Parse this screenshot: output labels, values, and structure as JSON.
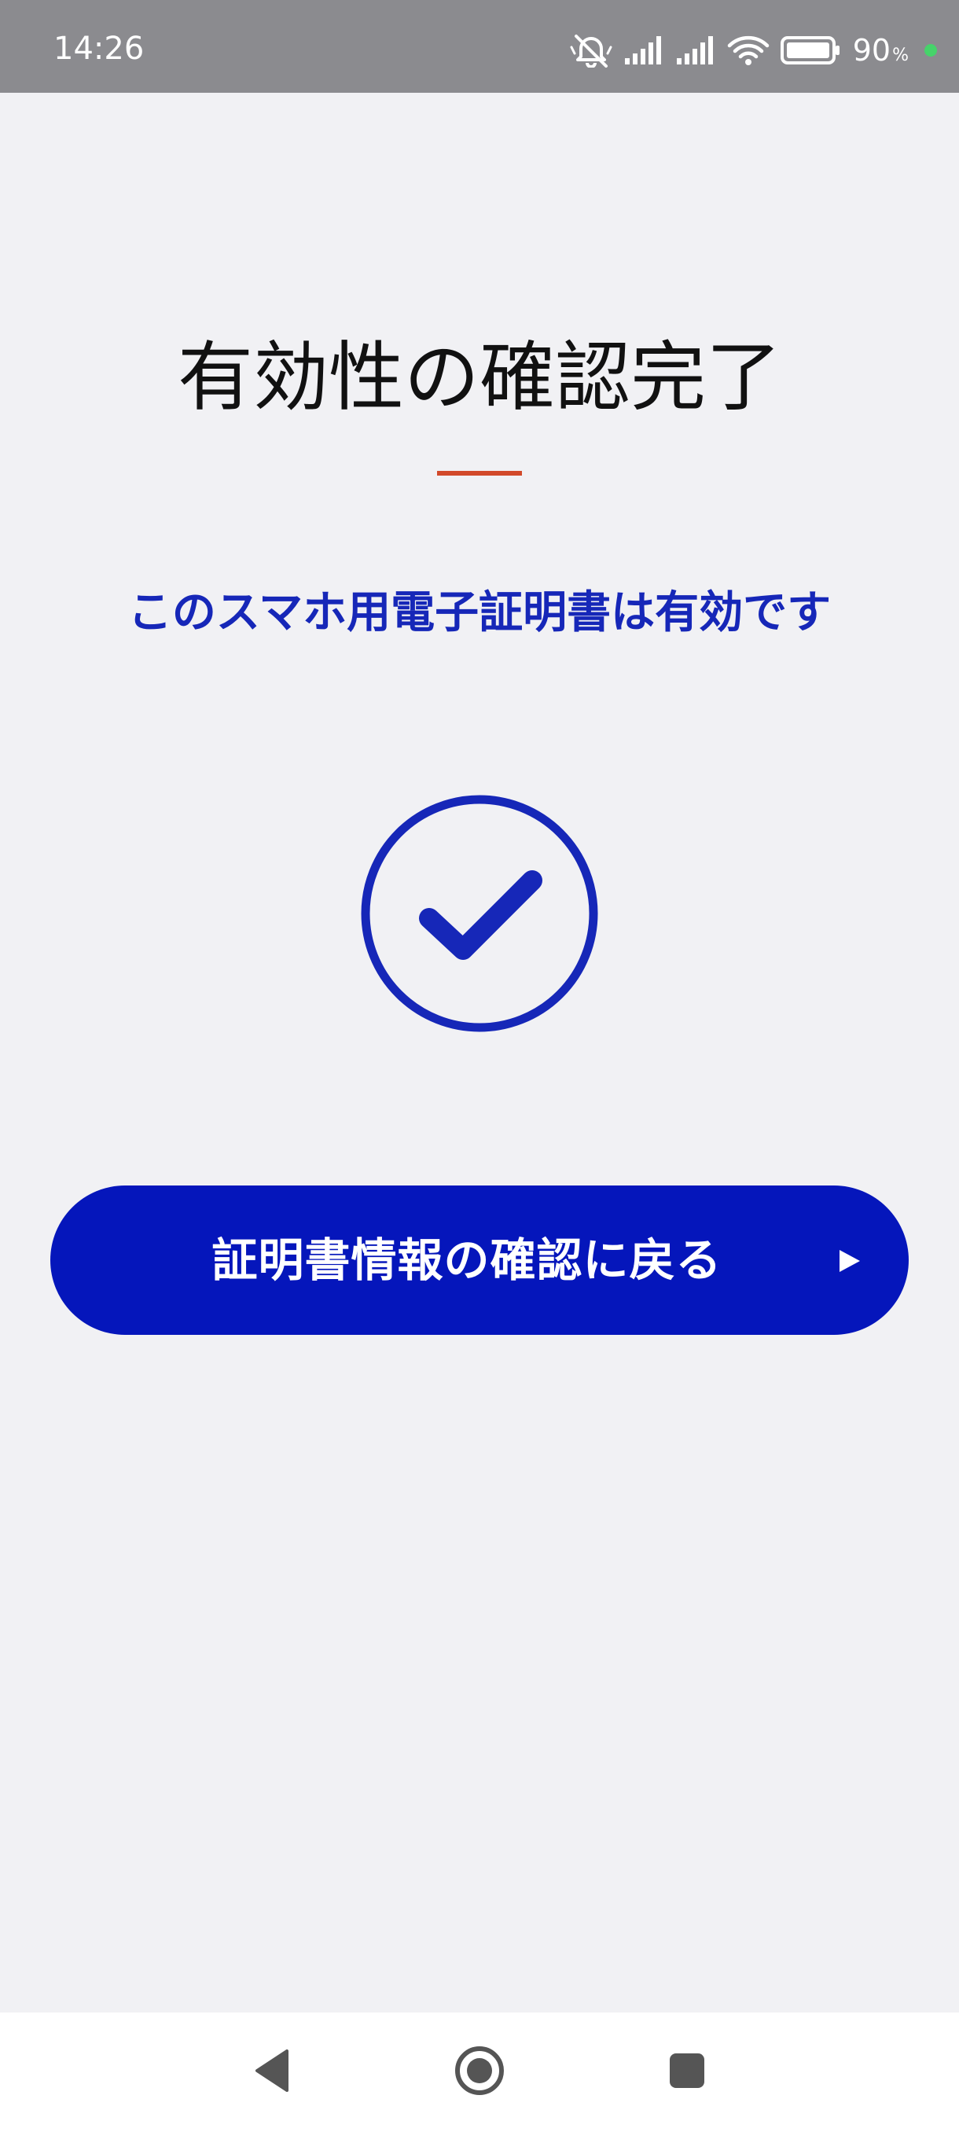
{
  "status_bar": {
    "time": "14:26",
    "battery_level": "90",
    "battery_unit": "%",
    "icons": [
      "mute-icon",
      "signal-icon",
      "signal-icon",
      "wifi-icon",
      "battery-icon",
      "privacy-dot"
    ]
  },
  "main": {
    "title": "有効性の確認完了",
    "subtitle": "このスマホ用電子証明書は有効です",
    "status_icon": "check-circle-icon",
    "back_button_label": "証明書情報の確認に戻る",
    "back_button_icon": "play-icon"
  },
  "nav_bar": {
    "buttons": [
      "back-icon",
      "home-icon",
      "recents-icon"
    ]
  },
  "colors": {
    "accent": "#0516bb",
    "subtitle": "#1627b8",
    "underline": "#d2492a",
    "status_bar_bg": "#8b8b8f",
    "background": "#f1f1f4"
  }
}
